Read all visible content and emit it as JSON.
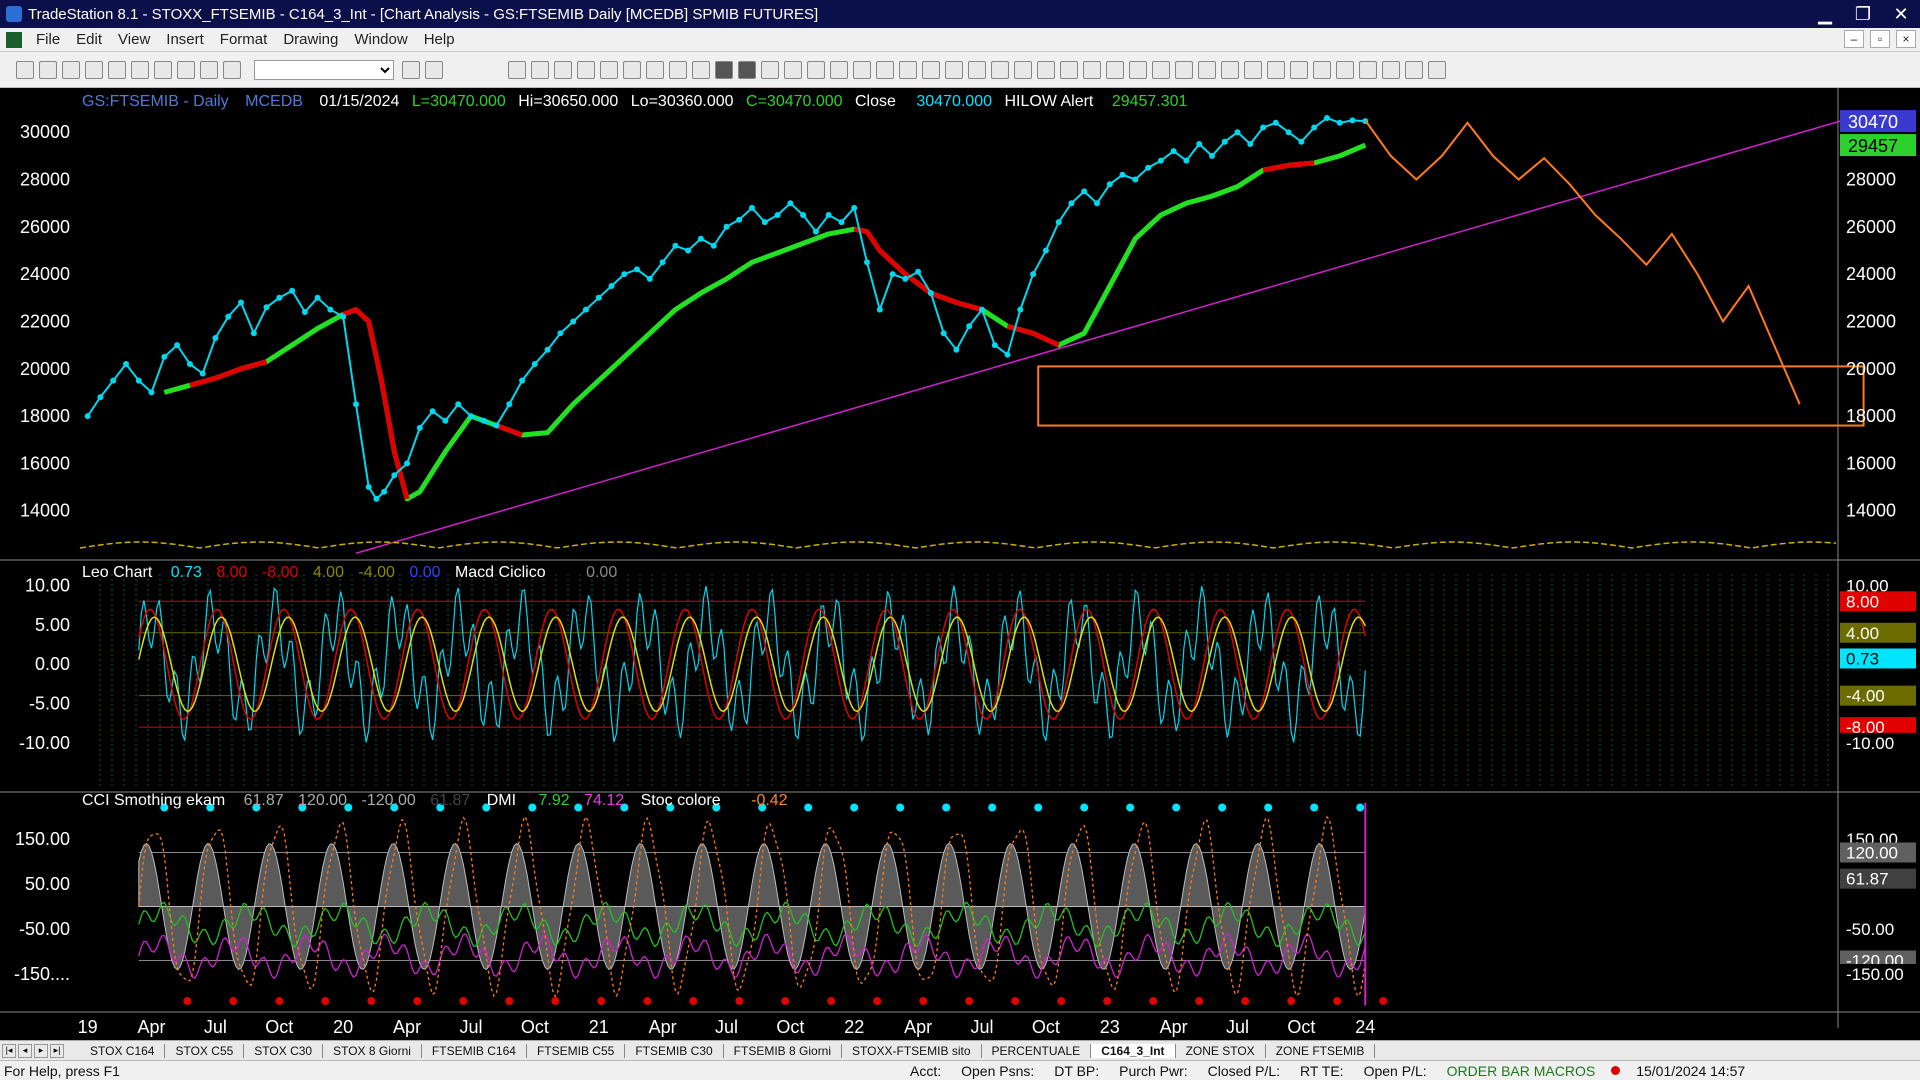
{
  "window": {
    "title": "TradeStation 8.1 - STOXX_FTSEMIB - C164_3_Int - [Chart Analysis - GS:FTSEMIB  Daily  [MCEDB] SPMIB FUTURES]",
    "minimize": "▁",
    "restore": "❐",
    "close": "✕"
  },
  "menu": [
    "File",
    "Edit",
    "View",
    "Insert",
    "Format",
    "Drawing",
    "Window",
    "Help"
  ],
  "doc_buttons": [
    "–",
    "▫",
    "×"
  ],
  "price_header": {
    "symbol": "GS:FTSEMIB - Daily",
    "feed": "MCEDB",
    "date": "01/15/2024",
    "last": "L=30470.000",
    "high": "Hi=30650.000",
    "low": "Lo=30360.000",
    "close_eq": "C=30470.000",
    "close_label": "Close",
    "close_val": "30470.000",
    "hilow_label": "HILOW Alert",
    "hilow_val": "29457.301"
  },
  "osc_header": {
    "name": "Leo Chart",
    "v1": "0.73",
    "v2": "8.00",
    "v3": "-8.00",
    "v4": "4.00",
    "v5": "-4.00",
    "v6": "0.00",
    "macd": "Macd Ciclico",
    "macd_val": "0.00"
  },
  "cci_header": {
    "name": "CCI Smothing ekam",
    "v1": "61.87",
    "v2": "120.00",
    "v3": "-120.00",
    "v4": "61.87",
    "dmi": "DMI",
    "dmi1": "7.92",
    "dmi2": "74.12",
    "stoc": "Stoc colore",
    "stoc_val": "-0.42"
  },
  "price_axis": {
    "labels": [
      "30000",
      "28000",
      "26000",
      "24000",
      "22000",
      "20000",
      "18000",
      "16000",
      "14000"
    ],
    "values": [
      30000,
      28000,
      26000,
      24000,
      22000,
      20000,
      18000,
      16000,
      14000
    ],
    "ylim": [
      12000,
      31700
    ],
    "last_tag": "30470",
    "alert_tag": "29457"
  },
  "osc_axis": {
    "labels": [
      "10.00",
      "5.00",
      "0.00",
      "-5.00",
      "-10.00"
    ],
    "values": [
      10,
      5,
      0,
      -5,
      -10
    ],
    "ylim": [
      -16,
      13
    ],
    "tags": [
      {
        "text": "10.00",
        "value": 10,
        "bg": "#000000",
        "fg": "#ffffff"
      },
      {
        "text": "8.00",
        "value": 8,
        "bg": "#e00000",
        "fg": "#ffffff"
      },
      {
        "text": "4.00",
        "value": 4,
        "bg": "#6b6b00",
        "fg": "#ffffff"
      },
      {
        "text": "0.73",
        "value": 0.73,
        "bg": "#00e5ff",
        "fg": "#000000"
      },
      {
        "text": "-4.00",
        "value": -4,
        "bg": "#6b6b00",
        "fg": "#ffffff"
      },
      {
        "text": "-8.00",
        "value": -8,
        "bg": "#e00000",
        "fg": "#ffffff"
      },
      {
        "text": "-10.00",
        "value": -10,
        "bg": "#000000",
        "fg": "#ffffff"
      }
    ]
  },
  "cci_axis": {
    "labels": [
      "150.00",
      "50.00",
      "-50.00",
      "-150...."
    ],
    "values": [
      150,
      50,
      -50,
      -150
    ],
    "ylim": [
      -230,
      250
    ],
    "tags": [
      {
        "text": "150.00",
        "value": 150,
        "bg": "#000000",
        "fg": "#ffffff"
      },
      {
        "text": "120.00",
        "value": 120,
        "bg": "#606060",
        "fg": "#ffffff"
      },
      {
        "text": "61.87",
        "value": 61.87,
        "bg": "#404040",
        "fg": "#ffffff"
      },
      {
        "text": "-50.00",
        "value": -50,
        "bg": "#000000",
        "fg": "#ffffff"
      },
      {
        "text": "-120.00",
        "value": -120,
        "bg": "#606060",
        "fg": "#ffffff"
      },
      {
        "text": "-150.00",
        "value": -150,
        "bg": "#000000",
        "fg": "#ffffff"
      }
    ]
  },
  "time_axis": [
    {
      "label": "19",
      "x": 2019.0
    },
    {
      "label": "Apr",
      "x": 2019.25
    },
    {
      "label": "Jul",
      "x": 2019.5
    },
    {
      "label": "Oct",
      "x": 2019.75
    },
    {
      "label": "20",
      "x": 2020.0
    },
    {
      "label": "Apr",
      "x": 2020.25
    },
    {
      "label": "Jul",
      "x": 2020.5
    },
    {
      "label": "Oct",
      "x": 2020.75
    },
    {
      "label": "21",
      "x": 2021.0
    },
    {
      "label": "Apr",
      "x": 2021.25
    },
    {
      "label": "Jul",
      "x": 2021.5
    },
    {
      "label": "Oct",
      "x": 2021.75
    },
    {
      "label": "22",
      "x": 2022.0
    },
    {
      "label": "Apr",
      "x": 2022.25
    },
    {
      "label": "Jul",
      "x": 2022.5
    },
    {
      "label": "Oct",
      "x": 2022.75
    },
    {
      "label": "23",
      "x": 2023.0
    },
    {
      "label": "Apr",
      "x": 2023.25
    },
    {
      "label": "Jul",
      "x": 2023.5
    },
    {
      "label": "Oct",
      "x": 2023.75
    },
    {
      "label": "24",
      "x": 2024.0
    }
  ],
  "chart_data": {
    "type": "line",
    "xlim": [
      2018.97,
      2025.85
    ],
    "price": {
      "x": [
        2019.0,
        2019.05,
        2019.1,
        2019.15,
        2019.2,
        2019.25,
        2019.3,
        2019.35,
        2019.4,
        2019.45,
        2019.5,
        2019.55,
        2019.6,
        2019.65,
        2019.7,
        2019.75,
        2019.8,
        2019.85,
        2019.9,
        2019.95,
        2020.0,
        2020.05,
        2020.1,
        2020.13,
        2020.16,
        2020.2,
        2020.25,
        2020.3,
        2020.35,
        2020.4,
        2020.45,
        2020.5,
        2020.55,
        2020.6,
        2020.65,
        2020.7,
        2020.75,
        2020.8,
        2020.85,
        2020.9,
        2020.95,
        2021.0,
        2021.05,
        2021.1,
        2021.15,
        2021.2,
        2021.25,
        2021.3,
        2021.35,
        2021.4,
        2021.45,
        2021.5,
        2021.55,
        2021.6,
        2021.65,
        2021.7,
        2021.75,
        2021.8,
        2021.85,
        2021.9,
        2021.95,
        2022.0,
        2022.05,
        2022.1,
        2022.15,
        2022.2,
        2022.25,
        2022.3,
        2022.35,
        2022.4,
        2022.45,
        2022.5,
        2022.55,
        2022.6,
        2022.65,
        2022.7,
        2022.75,
        2022.8,
        2022.85,
        2022.9,
        2022.95,
        2023.0,
        2023.05,
        2023.1,
        2023.15,
        2023.2,
        2023.25,
        2023.3,
        2023.35,
        2023.4,
        2023.45,
        2023.5,
        2023.55,
        2023.6,
        2023.65,
        2023.7,
        2023.75,
        2023.8,
        2023.85,
        2023.9,
        2023.95,
        2024.0
      ],
      "y": [
        18000,
        18800,
        19500,
        20200,
        19500,
        19000,
        20500,
        21000,
        20200,
        19800,
        21300,
        22200,
        22800,
        21500,
        22600,
        23000,
        23300,
        22400,
        23000,
        22500,
        22200,
        18500,
        15000,
        14500,
        14800,
        15500,
        16000,
        17500,
        18200,
        17800,
        18500,
        18000,
        17800,
        17600,
        18500,
        19500,
        20200,
        20800,
        21500,
        22000,
        22500,
        23000,
        23500,
        24000,
        24200,
        23800,
        24500,
        25200,
        25000,
        25500,
        25200,
        26000,
        26300,
        26800,
        26200,
        26500,
        27000,
        26500,
        25800,
        26500,
        26200,
        26800,
        24500,
        22500,
        24000,
        23800,
        24100,
        23200,
        21500,
        20800,
        21800,
        22500,
        21000,
        20600,
        22500,
        24000,
        25000,
        26200,
        27000,
        27500,
        27000,
        27800,
        28200,
        28000,
        28500,
        28800,
        29200,
        28800,
        29500,
        29000,
        29600,
        30000,
        29500,
        30200,
        30400,
        30000,
        29600,
        30200,
        30600,
        30400,
        30500,
        30470
      ]
    },
    "hilow_alert": {
      "x": [
        2019.3,
        2019.4,
        2019.5,
        2019.6,
        2019.7,
        2019.8,
        2019.9,
        2020.0,
        2020.05,
        2020.1,
        2020.15,
        2020.2,
        2020.25,
        2020.3,
        2020.4,
        2020.5,
        2020.6,
        2020.7,
        2020.8,
        2020.9,
        2021.0,
        2021.1,
        2021.2,
        2021.3,
        2021.4,
        2021.5,
        2021.6,
        2021.7,
        2021.8,
        2021.9,
        2022.0,
        2022.05,
        2022.1,
        2022.2,
        2022.3,
        2022.4,
        2022.5,
        2022.6,
        2022.7,
        2022.8,
        2022.9,
        2023.0,
        2023.1,
        2023.2,
        2023.3,
        2023.4,
        2023.5,
        2023.6,
        2023.7,
        2023.8,
        2023.9,
        2024.0
      ],
      "y": [
        19000,
        19300,
        19600,
        20000,
        20300,
        21000,
        21700,
        22300,
        22500,
        22000,
        19500,
        16500,
        14500,
        14800,
        16500,
        18000,
        17600,
        17200,
        17300,
        18500,
        19500,
        20500,
        21500,
        22500,
        23200,
        23800,
        24500,
        24900,
        25300,
        25700,
        25900,
        25800,
        25000,
        24000,
        23200,
        22800,
        22500,
        21800,
        21500,
        21000,
        21500,
        23500,
        25500,
        26500,
        27000,
        27300,
        27700,
        28400,
        28600,
        28700,
        29000,
        29457
      ],
      "red_segments": [
        [
          2019.4,
          2019.7
        ],
        [
          2019.95,
          2020.25
        ],
        [
          2020.55,
          2020.75
        ],
        [
          2022.0,
          2022.5
        ],
        [
          2022.6,
          2022.8
        ],
        [
          2023.0,
          2023.05
        ],
        [
          2023.55,
          2023.85
        ]
      ]
    },
    "forecast": {
      "x": [
        2024.0,
        2024.1,
        2024.2,
        2024.3,
        2024.4,
        2024.5,
        2024.6,
        2024.7,
        2024.8,
        2024.9,
        2025.0,
        2025.1,
        2025.2,
        2025.3,
        2025.4,
        2025.5,
        2025.6,
        2025.7
      ],
      "y": [
        30500,
        29000,
        28000,
        29000,
        30400,
        29000,
        28000,
        28900,
        27800,
        26500,
        25500,
        24400,
        25700,
        24000,
        22000,
        23500,
        21000,
        18500
      ]
    },
    "trendline": {
      "x": [
        2020.05,
        2025.9
      ],
      "y": [
        12200,
        30600
      ]
    },
    "support_box": {
      "x": [
        2022.72,
        2025.95
      ],
      "y": [
        17600,
        20100
      ]
    },
    "oscillator": {
      "bands": [
        8,
        4,
        -4,
        -8
      ],
      "band_colors": [
        "#e00000",
        "#6b6b00",
        "#6b6b00",
        "#e00000"
      ]
    },
    "cci": {
      "levels": [
        120,
        0,
        -120
      ]
    }
  },
  "tabs": [
    "STOX C164",
    "STOX C55",
    "STOX  C30",
    "STOX  8 Giorni",
    "FTSEMIB C164",
    "FTSEMIB C55",
    "FTSEMIB C30",
    "FTSEMIB  8 Giorni",
    "STOXX-FTSEMIB sito",
    "PERCENTUALE",
    "C164_3_Int",
    "ZONE STOX",
    "ZONE FTSEMIB"
  ],
  "active_tab": "C164_3_Int",
  "status": {
    "help": "For Help, press F1",
    "acct": "Acct:",
    "open_psns": "Open Psns:",
    "dt_bp": "DT BP:",
    "purch_pwr": "Purch Pwr:",
    "closed_pl": "Closed P/L:",
    "rt_te": "RT TE:",
    "open_pl": "Open P/L:",
    "macros": "ORDER BAR  MACROS",
    "datetime": "15/01/2024 14:57"
  }
}
